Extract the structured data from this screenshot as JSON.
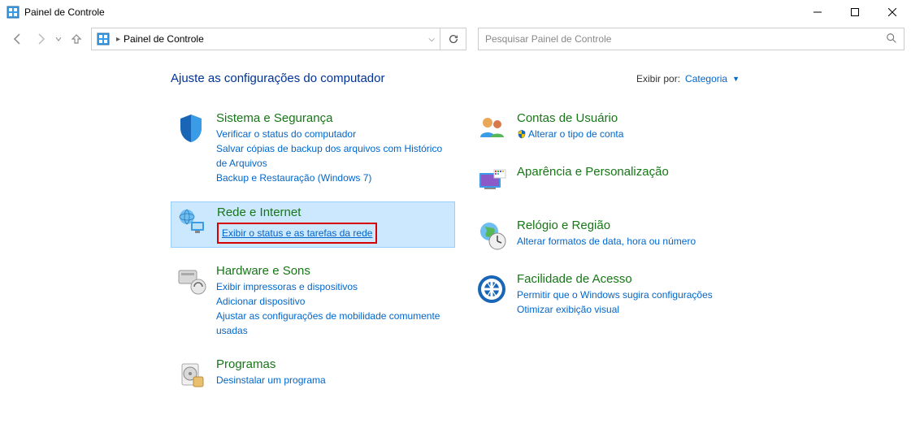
{
  "window": {
    "title": "Painel de Controle"
  },
  "nav": {
    "breadcrumb": "Painel de Controle",
    "search_placeholder": "Pesquisar Painel de Controle"
  },
  "header": {
    "title": "Ajuste as configurações do computador",
    "viewby_label": "Exibir por:",
    "viewby_value": "Categoria"
  },
  "categories": {
    "system_security": {
      "title": "Sistema e Segurança",
      "links": [
        "Verificar o status do computador",
        "Salvar cópias de backup dos arquivos com Histórico de Arquivos",
        "Backup e Restauração (Windows 7)"
      ]
    },
    "network": {
      "title": "Rede e Internet",
      "links": [
        "Exibir o status e as tarefas da rede"
      ]
    },
    "hardware": {
      "title": "Hardware e Sons",
      "links": [
        "Exibir impressoras e dispositivos",
        "Adicionar dispositivo",
        "Ajustar as configurações de mobilidade comumente usadas"
      ]
    },
    "programs": {
      "title": "Programas",
      "links": [
        "Desinstalar um programa"
      ]
    },
    "users": {
      "title": "Contas de Usuário",
      "links": [
        "Alterar o tipo de conta"
      ]
    },
    "appearance": {
      "title": "Aparência e Personalização"
    },
    "clock": {
      "title": "Relógio e Região",
      "links": [
        "Alterar formatos de data, hora ou número"
      ]
    },
    "ease": {
      "title": "Facilidade de Acesso",
      "links": [
        "Permitir que o Windows sugira configurações",
        "Otimizar exibição visual"
      ]
    }
  }
}
